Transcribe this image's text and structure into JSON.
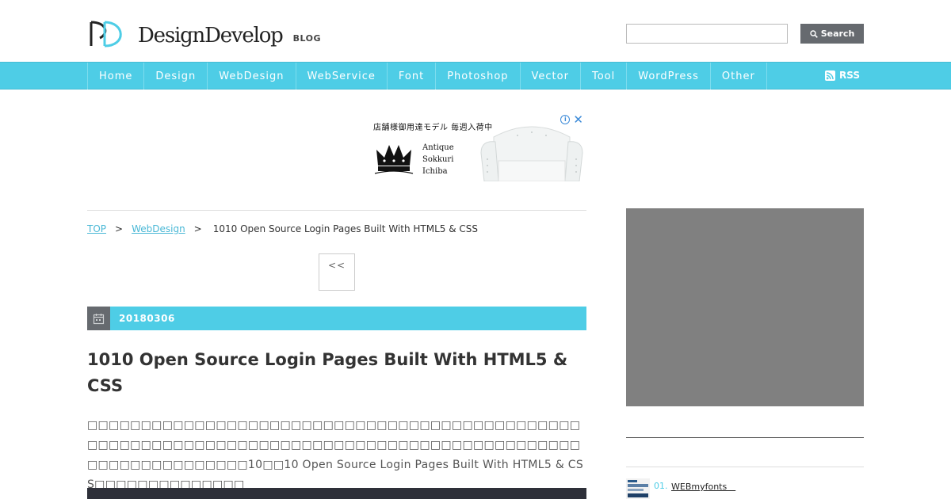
{
  "header": {
    "logo_text": "DesignDevelop",
    "logo_sub": "BLOG",
    "search": {
      "value": "",
      "placeholder": "",
      "button_label": "Search"
    }
  },
  "nav": {
    "items": [
      "Home",
      "Design",
      "WebDesign",
      "WebService",
      "Font",
      "Photoshop",
      "Vector",
      "Tool",
      "WordPress",
      "Other"
    ],
    "rss_label": "RSS"
  },
  "ad": {
    "headline": "店舗様御用達モデル 毎週入荷中",
    "brand_lines": [
      "Antique",
      "Sokkuri",
      "Ichiba"
    ]
  },
  "breadcrumb": {
    "top": "TOP",
    "sep": ">",
    "category": "WebDesign",
    "current": "1010 Open Source Login Pages Built With HTML5 & CSS"
  },
  "pager": {
    "prev_label": "<<"
  },
  "article": {
    "date": "20180306",
    "title": " 1010 Open Source Login Pages Built With HTML5 & CSS",
    "body": "□□□□□□□□□□□□□□□□□□□□□□□□□□□□□□□□□□□□□□□□□□□□□□□□□□□□□□□□□□□□□□□□□□□□□□□□□□□□□□□□□□□□□□□□□□□□□□□□□□□□□□□□□□□10□□10 Open Source Login Pages Built With HTML5 & CSS□□□□□□□□□□□□□□"
  },
  "sidebar": {
    "rank_items": [
      {
        "num": "01.",
        "label": "WEBmyfonts　"
      }
    ]
  },
  "colors": {
    "accent": "#4ecde6",
    "dark": "#666a6f",
    "link": "#4ab8d6",
    "ad_gray": "#808080"
  }
}
